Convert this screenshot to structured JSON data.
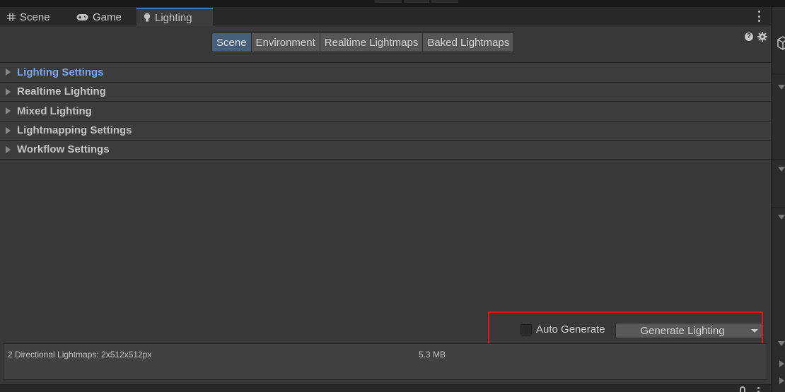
{
  "tabs": [
    {
      "label": "Scene",
      "icon": "grid-icon",
      "active": false
    },
    {
      "label": "Game",
      "icon": "gamepad-icon",
      "active": false
    },
    {
      "label": "Lighting",
      "icon": "lightbulb-icon",
      "active": true
    }
  ],
  "toolbar": {
    "segments": [
      "Scene",
      "Environment",
      "Realtime Lightmaps",
      "Baked Lightmaps"
    ],
    "active_segment": "Scene",
    "help_glyph": "?"
  },
  "foldouts": [
    {
      "label": "Lighting Settings",
      "highlighted": true
    },
    {
      "label": "Realtime Lighting",
      "highlighted": false
    },
    {
      "label": "Mixed Lighting",
      "highlighted": false
    },
    {
      "label": "Lightmapping Settings",
      "highlighted": false
    },
    {
      "label": "Workflow Settings",
      "highlighted": false
    }
  ],
  "controls": {
    "auto_generate_label": "Auto Generate",
    "auto_generate_checked": false,
    "generate_button_label": "Generate Lighting"
  },
  "info": {
    "lightmaps_text": "2 Directional Lightmaps: 2x512x512px",
    "size_text": "5.3 MB"
  },
  "colors": {
    "accent": "#3a79bb",
    "active_segment": "#46607c",
    "highlight_text": "#7ba7e0",
    "annotation_box": "#e0141a",
    "background": "#383838"
  }
}
